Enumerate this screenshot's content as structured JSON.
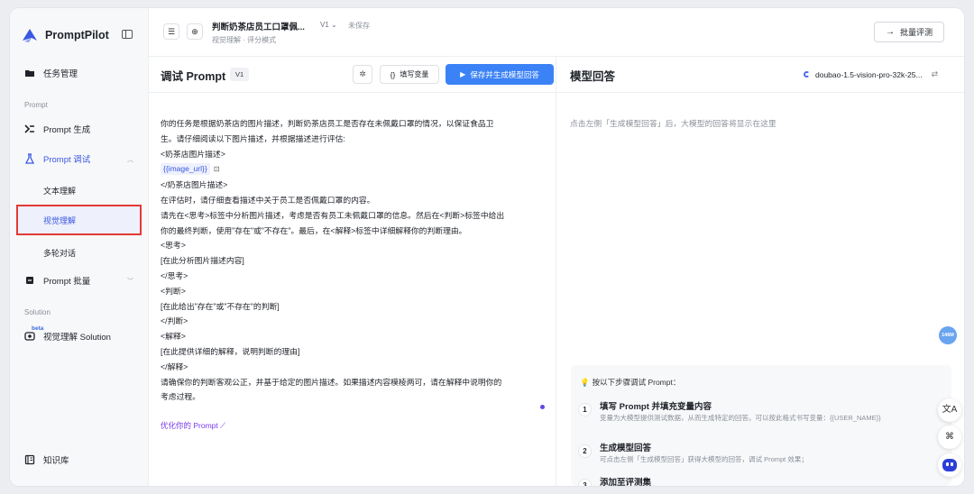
{
  "app": {
    "name": "PromptPilot"
  },
  "sidebar": {
    "items": [
      {
        "label": "任务管理",
        "icon": "folder-icon"
      },
      {
        "label": "Prompt 生成",
        "icon": "magic-icon"
      },
      {
        "label": "Prompt 调试",
        "icon": "flask-icon"
      },
      {
        "label": "Prompt 批量",
        "icon": "batch-icon"
      },
      {
        "label": "视觉理解 Solution",
        "icon": "eye-icon"
      },
      {
        "label": "知识库",
        "icon": "book-icon"
      }
    ],
    "sections": {
      "prompt": "Prompt",
      "solution": "Solution"
    },
    "subitems": [
      "文本理解",
      "视觉理解",
      "多轮对话"
    ],
    "beta": "beta"
  },
  "header": {
    "title": "判断奶茶店员工口罩佩...",
    "version": "V1 ⌄",
    "status": "未保存",
    "subtitle": "视觉理解 · 评分模式",
    "batch_label": "批量评测"
  },
  "editor": {
    "title": "调试 Prompt",
    "version": "V1",
    "fill_label": "填写变量",
    "save_label": "保存并生成模型回答",
    "lines": [
      "你的任务是根据奶茶店的图片描述，判断奶茶店员工是否存在未佩戴口罩的情况，以保证食品卫",
      "生。请仔细阅读以下图片描述，并根据描述进行评估:",
      "<奶茶店图片描述>",
      "",
      "</奶茶店图片描述>",
      "在评估时，请仔细查看描述中关于员工是否佩戴口罩的内容。",
      "请先在<思考>标签中分析图片描述，考虑是否有员工未佩戴口罩的信息。然后在<判断>标签中给出",
      "你的最终判断，使用\"存在\"或\"不存在\"。最后，在<解释>标签中详细解释你的判断理由。",
      "<思考>",
      "[在此分析图片描述内容]",
      "</思考>",
      "<判断>",
      "[在此给出\"存在\"或\"不存在\"的判断]",
      "</判断>",
      "<解释>",
      "[在此提供详细的解释，说明判断的理由]",
      "</解释>",
      "请确保你的判断客观公正，并基于给定的图片描述。如果描述内容模棱两可，请在解释中说明你的",
      "考虑过程。"
    ],
    "variable": "{{image_url}}",
    "optimize_label": "优化你的 Prompt"
  },
  "response": {
    "title": "模型回答",
    "model": "doubao-1.5-vision-pro-32k-25...",
    "hint": "点击左侧「生成模型回答」后，大模型的回答将显示在这里",
    "steps_title": "按以下步骤调试 Prompt：",
    "steps": [
      {
        "num": "1",
        "title": "填写 Prompt 并填充变量内容",
        "desc": "变量为大模型提供测试数据，从而生成特定的回答。可以按此格式书写变量：{{USER_NAME}}"
      },
      {
        "num": "2",
        "title": "生成模型回答",
        "desc": "可点击左侧「生成模型回答」获得大模型的回答，调试 Prompt 效果；"
      },
      {
        "num": "3",
        "title": "添加至评测集",
        "desc": ""
      }
    ]
  },
  "floating": {
    "badge": "146M"
  },
  "colors": {
    "primary": "#3b82f6",
    "accent_purple": "#7c3aed",
    "highlight_red": "#e23a36"
  }
}
